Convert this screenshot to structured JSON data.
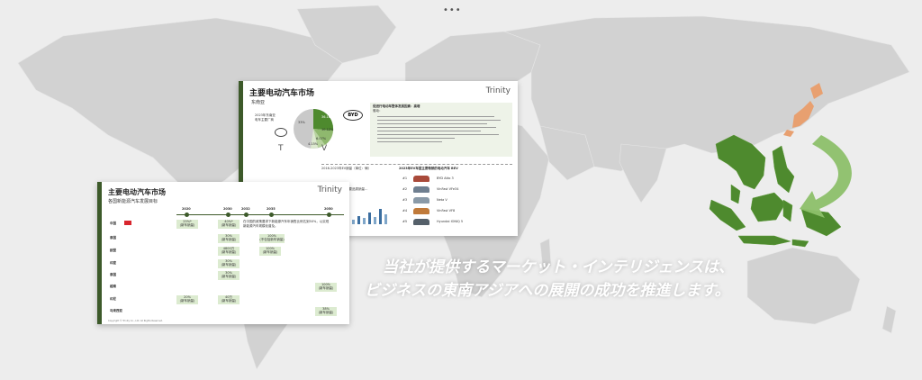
{
  "caption": {
    "line1": "当社が提供するマーケット・インテリジェンスは、",
    "line2": "ビジネスの東南アジアへの展開の成功を推進します。"
  },
  "slide_back": {
    "title": "主要电动汽车市场",
    "subtitle": "东南亚",
    "logo": "Trinity",
    "pie_heading_line1": "2023年东南亚",
    "pie_heading_line2": "电车主要厂商",
    "pie_values": [
      "36.16%",
      "10.12%",
      "6.07%",
      "4.15%",
      "33%"
    ],
    "brand_byd": "BYD",
    "notes_heading": "促进行电动车整体发展因素：高增",
    "notes_sub": "驱动：",
    "bottom_left_title": "2016-2023年EV销量（单位：辆）",
    "bottom_left_note": "…度主要品类销量…",
    "bottom_right_title": "2023年EV车型主要畅销的电动汽车 BEV",
    "bottom_right_brand": "BEV",
    "models": [
      "BYD Atto 3",
      "VinFast VFe34",
      "Neta V",
      "VinFast VF8",
      "Hyundai IONIQ 5"
    ],
    "ranks": [
      "#1",
      "#2",
      "#3",
      "#4",
      "#5"
    ]
  },
  "slide_front": {
    "title": "主要电动汽车市场",
    "subtitle": "各国新能源汽车发展目标",
    "logo": "Trinity",
    "years": [
      "2020",
      "2030",
      "2032",
      "2035",
      "2050"
    ],
    "countries": [
      "中国",
      "泰国",
      "欧盟",
      "印度",
      "泰国",
      "越南",
      "印尼",
      "马来西亚"
    ],
    "china_note": "在中国的政策要求下新能源汽车年销售比例达到50%，以实现新能源汽车规模化普及。",
    "targets": {
      "china_2020": "25%*",
      "china_2030": "40%*",
      "thailand_2030": "30%",
      "thailand_2035": "100%",
      "eu_2030": "4800万",
      "eu_2035": "100%",
      "india_2030": "30%",
      "thailand2_2030": "30%",
      "vietnam_2050": "100%",
      "indonesia_2020": "20%",
      "indonesia_2030": "40万",
      "malaysia_2050": "38%"
    },
    "target_sub": "(新车销量)",
    "target_sub_alt": "(不包括新车销量)",
    "copyright": "Copyright © Trinity Co., Ltd. All Rights Reserved."
  },
  "colors": {
    "background": "#ededed",
    "land": "#d0d0d0",
    "sea_highlight": "#4e8a2e",
    "japan": "#e8a070",
    "arrow": "#8dc06a",
    "slide_bar": "#3d5a2a"
  }
}
